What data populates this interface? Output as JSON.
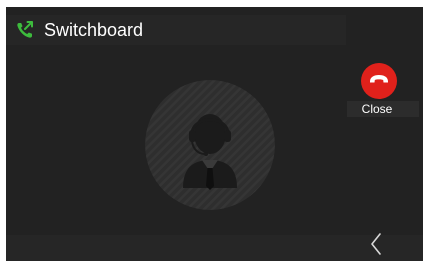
{
  "header": {
    "title": "Switchboard",
    "icon": "phone-transfer-icon",
    "icon_color": "#3dbb3d"
  },
  "avatar": {
    "icon": "operator-headset-icon"
  },
  "close_action": {
    "label": "Close",
    "icon": "hang-up-icon",
    "color": "#e0211b"
  },
  "navigation": {
    "back_icon": "chevron-left-icon"
  }
}
